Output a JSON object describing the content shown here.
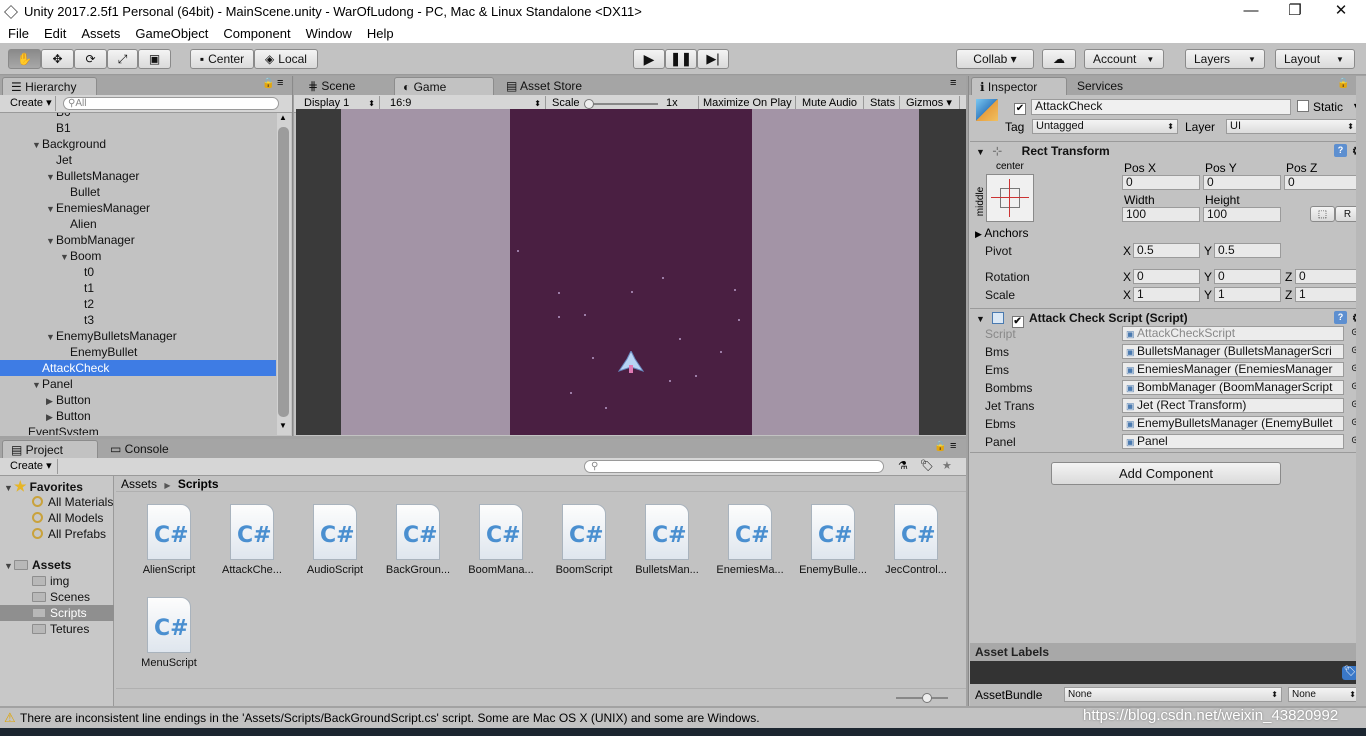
{
  "window": {
    "title": "Unity 2017.2.5f1 Personal (64bit) - MainScene.unity - WarOfLudong - PC, Mac & Linux Standalone <DX11>",
    "minimize": "—",
    "maximize": "❐",
    "close": "✕"
  },
  "menu": [
    "File",
    "Edit",
    "Assets",
    "GameObject",
    "Component",
    "Window",
    "Help"
  ],
  "toolbar": {
    "center_label": "Center",
    "local_label": "Local",
    "collab_label": "Collab ▾",
    "account_label": "Account",
    "layers_label": "Layers",
    "layout_label": "Layout"
  },
  "hierarchy": {
    "tab_label": "Hierarchy",
    "create_label": "Create",
    "search_placeholder": "All",
    "items": [
      {
        "label": "B0",
        "indent": 58,
        "arrow": ""
      },
      {
        "label": "B1",
        "indent": 58,
        "arrow": ""
      },
      {
        "label": "Background",
        "indent": 44,
        "arrow": "▼"
      },
      {
        "label": "Jet",
        "indent": 58,
        "arrow": ""
      },
      {
        "label": "BulletsManager",
        "indent": 58,
        "arrow": "▼"
      },
      {
        "label": "Bullet",
        "indent": 72,
        "arrow": ""
      },
      {
        "label": "EnemiesManager",
        "indent": 58,
        "arrow": "▼"
      },
      {
        "label": "Alien",
        "indent": 72,
        "arrow": ""
      },
      {
        "label": "BombManager",
        "indent": 58,
        "arrow": "▼"
      },
      {
        "label": "Boom",
        "indent": 72,
        "arrow": "▼"
      },
      {
        "label": "t0",
        "indent": 86,
        "arrow": ""
      },
      {
        "label": "t1",
        "indent": 86,
        "arrow": ""
      },
      {
        "label": "t2",
        "indent": 86,
        "arrow": ""
      },
      {
        "label": "t3",
        "indent": 86,
        "arrow": ""
      },
      {
        "label": "EnemyBulletsManager",
        "indent": 58,
        "arrow": "▼"
      },
      {
        "label": "EnemyBullet",
        "indent": 72,
        "arrow": ""
      },
      {
        "label": "AttackCheck",
        "indent": 44,
        "arrow": "",
        "selected": true
      },
      {
        "label": "Panel",
        "indent": 44,
        "arrow": "▼"
      },
      {
        "label": "Button",
        "indent": 58,
        "arrow": "▶"
      },
      {
        "label": "Button",
        "indent": 58,
        "arrow": "▶"
      },
      {
        "label": "EventSystem",
        "indent": 30,
        "arrow": ""
      }
    ]
  },
  "center": {
    "tabs": {
      "scene": "Scene",
      "game": "Game",
      "asset_store": "Asset Store"
    },
    "display": "Display 1",
    "aspect": "16:9",
    "scale_label": "Scale",
    "scale_value": "1x",
    "maximize": "Maximize On Play",
    "mute": "Mute Audio",
    "stats": "Stats",
    "gizmos": "Gizmos"
  },
  "inspector": {
    "tab_label": "Inspector",
    "services_label": "Services",
    "object_name": "AttackCheck",
    "static_label": "Static",
    "tag_label": "Tag",
    "tag_value": "Untagged",
    "layer_label": "Layer",
    "layer_value": "UI",
    "rect_transform": {
      "title": "Rect Transform",
      "anchor_h": "center",
      "anchor_v": "middle",
      "posx_label": "Pos X",
      "posy_label": "Pos Y",
      "posz_label": "Pos Z",
      "posx": "0",
      "posy": "0",
      "posz": "0",
      "width_label": "Width",
      "height_label": "Height",
      "width": "100",
      "height": "100",
      "anchors_label": "Anchors",
      "pivot_label": "Pivot",
      "pivot_x": "0.5",
      "pivot_y": "0.5",
      "rotation_label": "Rotation",
      "rot_x": "0",
      "rot_y": "0",
      "rot_z": "0",
      "scale_label": "Scale",
      "scale_x": "1",
      "scale_y": "1",
      "scale_z": "1",
      "x": "X",
      "y": "Y",
      "z": "Z",
      "r_btn": "R"
    },
    "script_component": {
      "title": "Attack Check Script (Script)",
      "fields": [
        {
          "label": "Script",
          "value": "AttackCheckScript",
          "disabled": true
        },
        {
          "label": "Bms",
          "value": "BulletsManager (BulletsManagerScri"
        },
        {
          "label": "Ems",
          "value": "EnemiesManager (EnemiesManager"
        },
        {
          "label": "Bombms",
          "value": "BombManager (BoomManagerScript"
        },
        {
          "label": "Jet Trans",
          "value": "Jet (Rect Transform)"
        },
        {
          "label": "Ebms",
          "value": "EnemyBulletsManager (EnemyBullet"
        },
        {
          "label": "Panel",
          "value": "Panel"
        }
      ]
    },
    "add_component": "Add Component",
    "asset_labels": "Asset Labels",
    "asset_bundle_label": "AssetBundle",
    "asset_bundle_value": "None",
    "asset_bundle_variant": "None"
  },
  "project": {
    "tab_label": "Project",
    "console_label": "Console",
    "create_label": "Create",
    "favorites_label": "Favorites",
    "favorites": [
      "All Materials",
      "All Models",
      "All Prefabs"
    ],
    "assets_label": "Assets",
    "folders": [
      "img",
      "Scenes",
      "Scripts",
      "Tetures"
    ],
    "breadcrumb_root": "Assets",
    "breadcrumb_current": "Scripts",
    "scripts": [
      "AlienScript",
      "AttackChe...",
      "AudioScript",
      "BackGroun...",
      "BoomMana...",
      "BoomScript",
      "BulletsMan...",
      "EnemiesMa...",
      "EnemyBulle...",
      "JecControl...",
      "MenuScript"
    ]
  },
  "status": {
    "message": "There are inconsistent line endings in the 'Assets/Scripts/BackGroundScript.cs' script. Some are Mac OS X (UNIX) and some are Windows.",
    "watermark": "https://blog.csdn.net/weixin_43820992"
  },
  "colors": {
    "selection": "#3e7ce4",
    "game_bg": "#4a1f42",
    "side_bg": "#a394a6"
  }
}
